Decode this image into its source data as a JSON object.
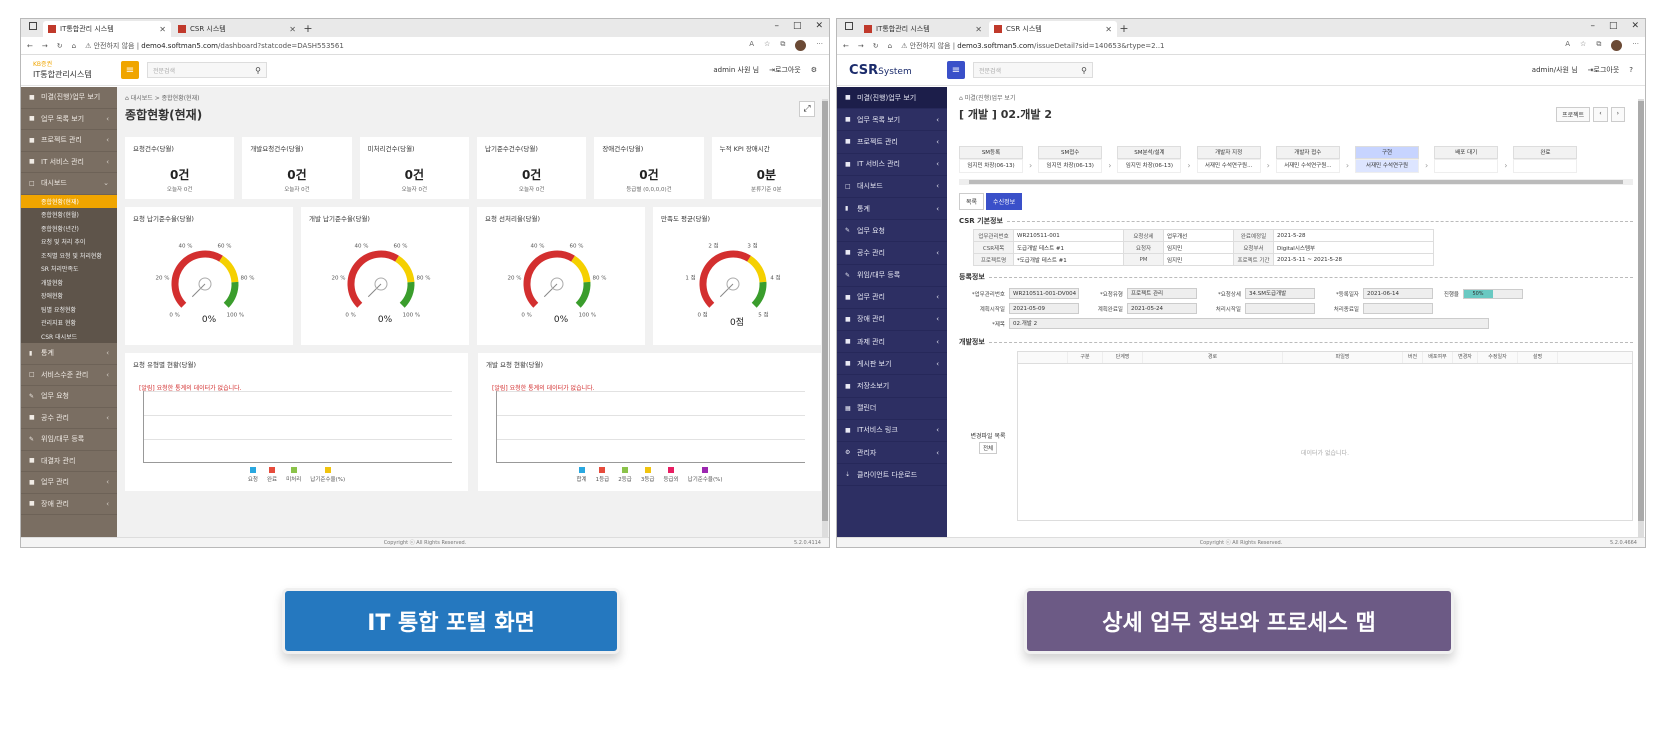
{
  "left": {
    "browser": {
      "tabs": [
        {
          "title": "IT통합관리 시스템",
          "active": true
        },
        {
          "title": "CSR 시스템",
          "active": false
        }
      ],
      "security": "안전하지 않음",
      "url_host": "demo4.softman5.com",
      "url_path": "/dashboard?statcode=DASH553561"
    },
    "app": {
      "brand": "KB증권",
      "system_name": "IT통합관리시스템",
      "search_placeholder": "전문검색",
      "user": "admin 사원 님",
      "logout": "로그아웃"
    },
    "sidebar": {
      "items": [
        {
          "icon": "■",
          "label": "미결(진행)업무 보기",
          "chevron": ""
        },
        {
          "icon": "■",
          "label": "업무 목록 보기",
          "chevron": "‹"
        },
        {
          "icon": "■",
          "label": "프로젝트 관리",
          "chevron": "‹"
        },
        {
          "icon": "■",
          "label": "IT 서비스 관리",
          "chevron": "‹"
        },
        {
          "icon": "□",
          "label": "대시보드",
          "chevron": "⌄"
        }
      ],
      "subitems": [
        {
          "label": "종합현황(현재)",
          "active": true
        },
        {
          "label": "종합현황(현월)",
          "active": false
        },
        {
          "label": "종합현황(년간)",
          "active": false
        },
        {
          "label": "요청 및 처리 추이",
          "active": false
        },
        {
          "label": "조직별 요청 및 처리현황",
          "active": false
        },
        {
          "label": "SR 처리만족도",
          "active": false
        },
        {
          "label": "개발현황",
          "active": false
        },
        {
          "label": "장애현황",
          "active": false
        },
        {
          "label": "팀별 요청현황",
          "active": false
        },
        {
          "label": "관리지표 현황",
          "active": false
        },
        {
          "label": "CSR 대시보드",
          "active": false
        }
      ],
      "items_after": [
        {
          "icon": "▮",
          "label": "통계",
          "chevron": "‹"
        },
        {
          "icon": "□",
          "label": "서비스수준 관리",
          "chevron": "‹"
        },
        {
          "icon": "✎",
          "label": "업무 요청",
          "chevron": ""
        },
        {
          "icon": "■",
          "label": "공수 관리",
          "chevron": "‹"
        },
        {
          "icon": "✎",
          "label": "위임/대무 등록",
          "chevron": ""
        },
        {
          "icon": "■",
          "label": "대결자 관리",
          "chevron": ""
        },
        {
          "icon": "■",
          "label": "업무 관리",
          "chevron": "‹"
        },
        {
          "icon": "■",
          "label": "장애 관리",
          "chevron": "‹"
        }
      ]
    },
    "breadcrumb": "대시보드 > 종합현황(현재)",
    "page_title": "종합현황(현재)",
    "kpis": [
      {
        "title": "요청건수(당월)",
        "value": "0건",
        "sub": "오늘자 0건"
      },
      {
        "title": "개발요청건수(당월)",
        "value": "0건",
        "sub": "오늘자 0건"
      },
      {
        "title": "미처리건수(당월)",
        "value": "0건",
        "sub": "오늘자 0건"
      },
      {
        "title": "납기준수건수(당월)",
        "value": "0건",
        "sub": "오늘자 0건"
      },
      {
        "title": "장애건수(당월)",
        "value": "0건",
        "sub": "등급별 (0,0,0,0)건"
      },
      {
        "title": "누적 KPI 장애시간",
        "value": "0분",
        "sub": "분류기준 0분"
      }
    ],
    "gauges": [
      {
        "title": "요청 납기준수율(당월)",
        "value": "0%",
        "ticks": [
          "0 %",
          "20 %",
          "40 %",
          "60 %",
          "80 %",
          "100 %"
        ],
        "level": 0
      },
      {
        "title": "개발 납기준수율(당월)",
        "value": "0%",
        "ticks": [
          "0 %",
          "20 %",
          "40 %",
          "60 %",
          "80 %",
          "100 %"
        ],
        "level": 0
      },
      {
        "title": "요청 선처리율(당월)",
        "value": "0%",
        "ticks": [
          "0 %",
          "20 %",
          "40 %",
          "60 %",
          "80 %",
          "100 %"
        ],
        "level": 0
      },
      {
        "title": "만족도 평균(당월)",
        "value": "0점",
        "ticks": [
          "0 점",
          "1 점",
          "2 점",
          "3 점",
          "4 점",
          "5 점"
        ],
        "level": 0
      }
    ],
    "charts": [
      {
        "title": "요청 유형별 현황(당월)",
        "message": "[알림] 요청한 통계의 데이터가 없습니다.",
        "legend": [
          {
            "name": "요청",
            "color": "#29a8e0"
          },
          {
            "name": "완료",
            "color": "#e74c3c"
          },
          {
            "name": "미처리",
            "color": "#8bc34a"
          },
          {
            "name": "납기준수율(%)",
            "color": "#f1c40f"
          }
        ]
      },
      {
        "title": "개발 요청 현황(당월)",
        "message": "[알림] 요청한 통계의 데이터가 없습니다.",
        "legend": [
          {
            "name": "합계",
            "color": "#29a8e0"
          },
          {
            "name": "1등급",
            "color": "#e74c3c"
          },
          {
            "name": "2등급",
            "color": "#8bc34a"
          },
          {
            "name": "3등급",
            "color": "#f1c40f"
          },
          {
            "name": "등급외",
            "color": "#e91e63"
          },
          {
            "name": "납기준수율(%)",
            "color": "#9c27b0"
          }
        ]
      }
    ],
    "footer": "Copyright ⓒ All Rights Reserved.",
    "version": "5.2.0.4114",
    "accent": "#f0a500"
  },
  "right": {
    "browser": {
      "tabs": [
        {
          "title": "IT통합관리 시스템",
          "active": false
        },
        {
          "title": "CSR 시스템",
          "active": true
        }
      ],
      "security": "안전하지 않음",
      "url_host": "demo3.softman5.com",
      "url_path": "/issueDetail?sid=140653&rtype=2..1"
    },
    "app": {
      "logo": "CSR",
      "logo_suffix": "System",
      "search_placeholder": "전문검색",
      "user": "admin/사원 님",
      "logout": "로그아웃",
      "help": "?"
    },
    "sidebar": [
      {
        "icon": "■",
        "label": "미결(진행)업무 보기",
        "chevron": "",
        "active": true
      },
      {
        "icon": "■",
        "label": "업무 목록 보기",
        "chevron": "‹"
      },
      {
        "icon": "■",
        "label": "프로젝트 관리",
        "chevron": "‹"
      },
      {
        "icon": "■",
        "label": "IT 서비스 관리",
        "chevron": "‹"
      },
      {
        "icon": "□",
        "label": "대시보드",
        "chevron": "‹"
      },
      {
        "icon": "▮",
        "label": "통계",
        "chevron": "‹"
      },
      {
        "icon": "✎",
        "label": "업무 요청",
        "chevron": ""
      },
      {
        "icon": "■",
        "label": "공수 관리",
        "chevron": "‹"
      },
      {
        "icon": "✎",
        "label": "위임/대무 등록",
        "chevron": ""
      },
      {
        "icon": "■",
        "label": "업무 관리",
        "chevron": "‹"
      },
      {
        "icon": "■",
        "label": "장애 관리",
        "chevron": "‹"
      },
      {
        "icon": "■",
        "label": "과제 관리",
        "chevron": "‹"
      },
      {
        "icon": "■",
        "label": "게시판 보기",
        "chevron": "‹"
      },
      {
        "icon": "■",
        "label": "저장소보기",
        "chevron": ""
      },
      {
        "icon": "▦",
        "label": "캘린더",
        "chevron": ""
      },
      {
        "icon": "■",
        "label": "IT서비스 링크",
        "chevron": "‹"
      },
      {
        "icon": "⚙",
        "label": "관리자",
        "chevron": "‹"
      },
      {
        "icon": "⇣",
        "label": "클라이언트 다운로드",
        "chevron": ""
      }
    ],
    "breadcrumb": "미결(진행)업무 보기",
    "page_title": "[ 개발 ] 02.개발 2",
    "top_buttons": [
      "프로젝트",
      "‹",
      "›"
    ],
    "steps": [
      {
        "head": "SM등록",
        "body": "임지민 차장(06-13)",
        "current": false
      },
      {
        "head": "SM접수",
        "body": "임지민 차장(06-13)",
        "current": false
      },
      {
        "head": "SM분석/설계",
        "body": "임지민 차장(06-13)",
        "current": false
      },
      {
        "head": "개발자 지정",
        "body": "서재민 수석연구원...",
        "current": false
      },
      {
        "head": "개발자 접수",
        "body": "서재민 수석연구원...",
        "current": false
      },
      {
        "head": "구현",
        "body": "서재민 수석연구원",
        "current": true
      },
      {
        "head": "배포 대기",
        "body": "",
        "current": false
      },
      {
        "head": "완료",
        "body": "",
        "current": false
      }
    ],
    "tabs": [
      {
        "label": "목록",
        "active": false
      },
      {
        "label": "수신정보",
        "active": true
      }
    ],
    "csr_section": "CSR 기본정보",
    "csr_rows": [
      [
        "업무관리번호",
        "WR210511-001",
        "요청상세",
        "업무개선",
        "완료예정일",
        "2021-5-28"
      ],
      [
        "CSR제목",
        "도급개발 테스트 #1",
        "요청자",
        "임지민",
        "요청부서",
        "Digital시스템부"
      ],
      [
        "프로젝트명",
        "*도급개발 테스트 #1",
        "PM",
        "임지민",
        "프로젝트 기간",
        "2021-5-11 ~ 2021-5-28"
      ]
    ],
    "reg_section": "등록정보",
    "reg": {
      "mgmt_no_label": "*업무관리번호",
      "mgmt_no": "WR210511-001-DV004",
      "req_type_label": "*요청유형",
      "req_type": "프로젝트 관리",
      "req_detail_label": "*요청상세",
      "req_detail": "34.SM도급개발",
      "reg_date_label": "*등록일자",
      "reg_date": "2021-06-14",
      "progress_label": "진행율",
      "progress": "50%",
      "progress_value": 0.5,
      "plan_start_label": "계획시작일",
      "plan_start": "2021-05-09",
      "plan_end_label": "계획완료일",
      "plan_end": "2021-05-24",
      "proc_start_label": "처리시작일",
      "proc_start": "",
      "proc_end_label": "처리종료일",
      "proc_end": "",
      "title_label": "*제목",
      "title": "02.개발 2"
    },
    "dev_section": "개발정보",
    "dev": {
      "side_label": "변경파일 목록",
      "side_button": "전체",
      "columns": [
        "",
        "구분",
        "단계명",
        "경로",
        "파일명",
        "버전",
        "배포여부",
        "변경자",
        "수정일자",
        "설명"
      ],
      "empty": "데이터가 없습니다."
    },
    "footer": "Copyright ⓒ All Rights Reserved.",
    "version": "5.2.0.4664",
    "accent": "#3a50c9"
  },
  "captions": {
    "left": "IT 통합 포털 화면",
    "right": "상세 업무 정보와 프로세스 맵"
  }
}
